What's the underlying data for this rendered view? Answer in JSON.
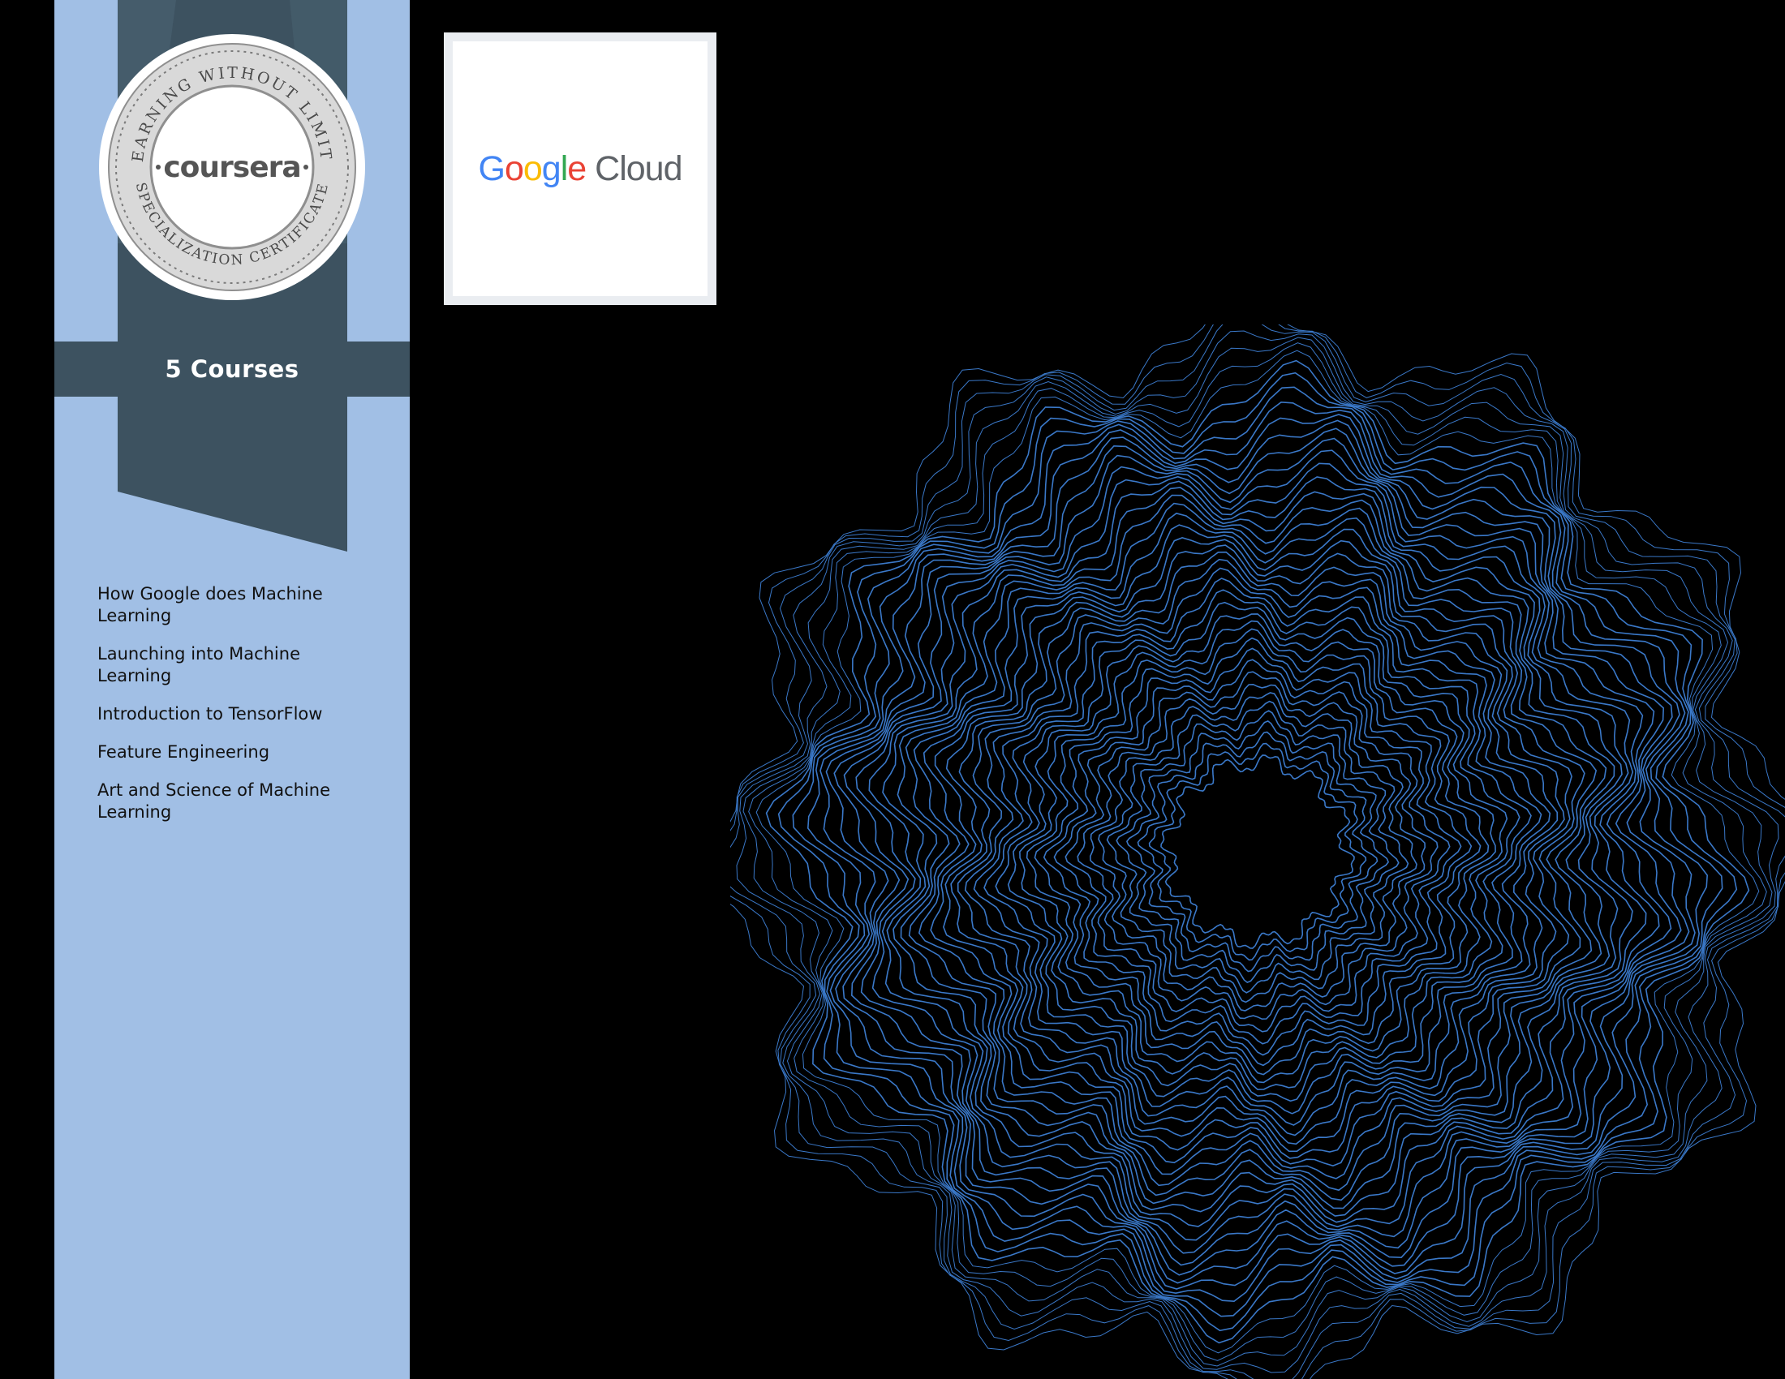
{
  "seal": {
    "top_text": "LEARNING WITHOUT LIMITS",
    "bottom_text": "SPECIALIZATION CERTIFICATE",
    "brand": "coursera"
  },
  "banner": {
    "courses_label": "5 Courses"
  },
  "courses": [
    "How Google does Machine Learning",
    "Launching into Machine Learning",
    "Introduction to TensorFlow",
    "Feature Engineering",
    "Art and Science of Machine Learning"
  ],
  "partner_logo": {
    "letters": [
      "G",
      "o",
      "o",
      "g",
      "l",
      "e"
    ],
    "product": "Cloud"
  },
  "colors": {
    "sidebar": "#a1bfe5",
    "ribbon": "#3d5260",
    "rosette_line": "#3a78c8",
    "background": "#000000"
  }
}
